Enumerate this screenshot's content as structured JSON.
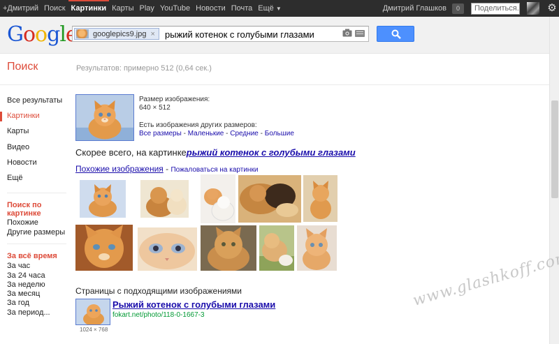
{
  "topbar": {
    "nav": [
      {
        "label": "+Дмитрий",
        "active": false
      },
      {
        "label": "Поиск",
        "active": false
      },
      {
        "label": "Картинки",
        "active": true
      },
      {
        "label": "Карты",
        "active": false
      },
      {
        "label": "Play",
        "active": false
      },
      {
        "label": "YouTube",
        "active": false
      },
      {
        "label": "Новости",
        "active": false
      },
      {
        "label": "Почта",
        "active": false
      },
      {
        "label": "Ещё",
        "active": false
      }
    ],
    "user_name": "Дмитрий Глашков",
    "notifications": "0",
    "share_label": "Поделиться...",
    "settings_icon": "gear-icon"
  },
  "logo": {
    "letters": [
      "G",
      "o",
      "o",
      "g",
      "l",
      "e"
    ]
  },
  "search": {
    "image_chip_name": "googlepics9.jpg",
    "chip_close": "×",
    "query": "рыжий котенок с голубыми глазами",
    "camera_icon": "camera-icon",
    "keyboard_icon": "keyboard-icon",
    "button_icon": "search-icon"
  },
  "results_header": {
    "title": "Поиск",
    "stats": "Результатов: примерно 512 (0,64 сек.)"
  },
  "sidebar": {
    "items": [
      {
        "label": "Все результаты",
        "active": false
      },
      {
        "label": "Картинки",
        "active": true
      },
      {
        "label": "Карты",
        "active": false
      },
      {
        "label": "Видео",
        "active": false
      },
      {
        "label": "Новости",
        "active": false
      },
      {
        "label": "Ещё",
        "active": false
      }
    ],
    "search_by_image": {
      "heading": "Поиск по картинке",
      "items": [
        "Похожие",
        "Другие размеры"
      ]
    },
    "time": {
      "heading": "За всё время",
      "items": [
        "За час",
        "За 24 часа",
        "За неделю",
        "За месяц",
        "За год",
        "За период..."
      ]
    }
  },
  "main": {
    "size_label": "Размер изображения:",
    "size_value": "640 × 512",
    "other_sizes_label": "Есть изображения других размеров:",
    "size_links": [
      "Все размеры",
      "Маленькие",
      "Средние",
      "Большие"
    ],
    "best_guess_prefix": "Скорее всего, на картинке",
    "best_guess_link": "рыжий котенок с голубыми глазами",
    "similar_link": "Похожие изображения",
    "similar_separator": " - ",
    "report_link": "Пожаловаться на картинки",
    "pages_title": "Страницы с подходящими изображениями",
    "result": {
      "title": "Рыжий котенок с голубыми глазами",
      "url": "fokart.net/photo/118-0-1667-3",
      "dims": "1024 × 768"
    }
  },
  "watermark": "www.glashkoff.com"
}
